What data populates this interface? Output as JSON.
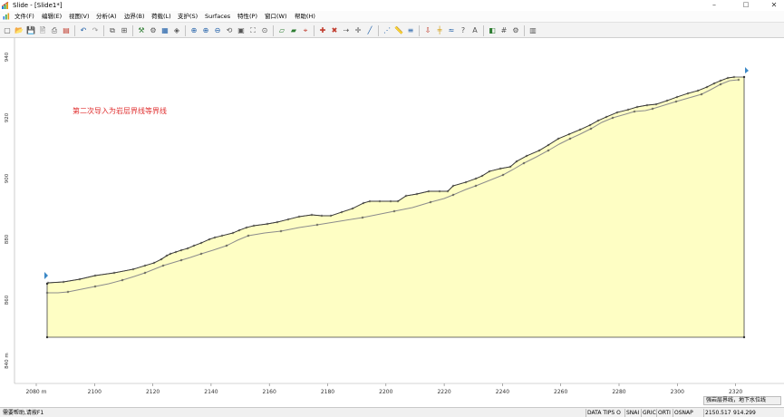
{
  "window": {
    "title": "Slide - [Slide1*]",
    "controls": {
      "minimize": "–",
      "maximize": "□",
      "close": "✕"
    }
  },
  "menu": [
    "文件(F)",
    "编辑(E)",
    "视图(V)",
    "分析(A)",
    "边界(B)",
    "荷载(L)",
    "支护(S)",
    "Surfaces",
    "特性(P)",
    "窗口(W)",
    "帮助(H)"
  ],
  "canvas": {
    "annotation": "第二次导入为岩层界线等界线",
    "annotation_color": "#e03030",
    "fill_color": "#fefec4",
    "x_axis_ticks": [
      "2080 m",
      "2100",
      "2120",
      "2140",
      "2160",
      "2180",
      "2200",
      "2220",
      "2240",
      "2260",
      "2280",
      "2300",
      "2320"
    ],
    "y_axis_ticks": [
      "940",
      "920",
      "900",
      "880",
      "860",
      "840 m"
    ]
  },
  "legend_tab": "强岩层界线，地下水位线",
  "status": {
    "help": "需要帮助,请按F1",
    "cells": [
      "DATA TIPS O",
      "SNAI",
      "GRIC",
      "ORTI",
      "OSNAP"
    ],
    "coord_x": "2150.517",
    "coord_y": "914.299"
  },
  "icons": {
    "toolbar": [
      "new-icon",
      "open-icon",
      "save-icon",
      "print-preview-icon",
      "print-icon",
      "rainbow-icon",
      "undo-icon",
      "redo-icon",
      "copy-icon",
      "tile-icon",
      "tools-icon",
      "analyze-icon",
      "compute-icon",
      "interpret-icon",
      "zoom-all-icon",
      "zoom-in-icon",
      "zoom-out-icon",
      "zoom-prev-icon",
      "zoom-window-icon",
      "zoom-extents-icon",
      "zoom-mouse-icon",
      "boundary-icon",
      "material-icon",
      "edit-vertex-icon",
      "add-vertex-icon",
      "delete-vertex-icon",
      "move-vertex-icon",
      "snap-icon",
      "line-icon",
      "polyline-icon",
      "measure-icon",
      "properties-icon",
      "load-icon",
      "support-icon",
      "water-icon",
      "query-icon",
      "labels-icon",
      "display-icon",
      "grid-icon",
      "options-icon",
      "tile-windows-icon"
    ]
  }
}
